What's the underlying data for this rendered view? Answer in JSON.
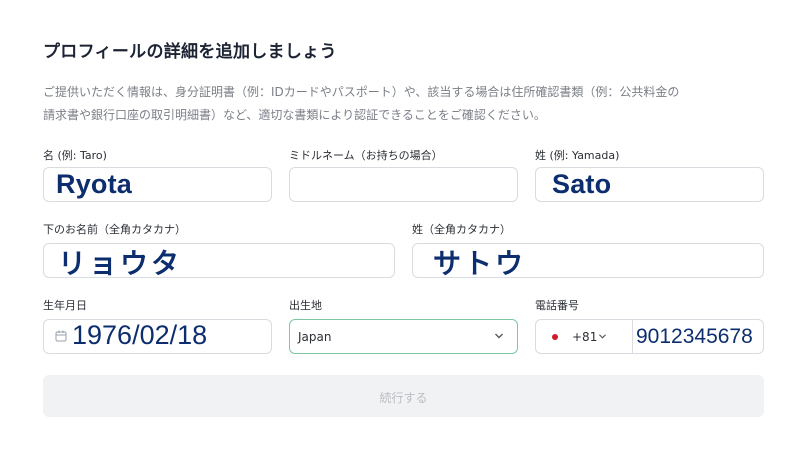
{
  "form": {
    "title": "プロフィールの詳細を追加しましょう",
    "description": "ご提供いただく情報は、身分証明書（例：IDカードやパスポート）や、該当する場合は住所確認書類（例：公共料金の\n請求書や銀行口座の取引明細書）など、適切な書類により認証できることをご確認ください。",
    "first_name": {
      "label": "名 (例: Taro)",
      "value": "Ryota"
    },
    "middle_name": {
      "label": "ミドルネーム（お持ちの場合）",
      "value": ""
    },
    "last_name": {
      "label": "姓 (例: Yamada)",
      "value": "Sato"
    },
    "first_name_kana": {
      "label": "下のお名前（全角カタカナ）",
      "value": "リョウタ"
    },
    "last_name_kana": {
      "label": "姓（全角カタカナ）",
      "value": "サトウ"
    },
    "birth_date": {
      "label": "生年月日",
      "value": "1976/02/18",
      "icon": "calendar-icon"
    },
    "birth_place": {
      "label": "出生地",
      "value": "Japan",
      "icon": "chevron-down-icon"
    },
    "phone": {
      "label": "電話番号",
      "country_code": "+81",
      "value": "9012345678",
      "flag": "japan-flag-icon"
    },
    "submit_label": "続行する",
    "colors": {
      "accent_value_text": "#0d2e6e",
      "select_border": "#7fc7a0",
      "flag_red": "#d11a2a",
      "disabled_button_bg": "#f1f2f4"
    }
  }
}
